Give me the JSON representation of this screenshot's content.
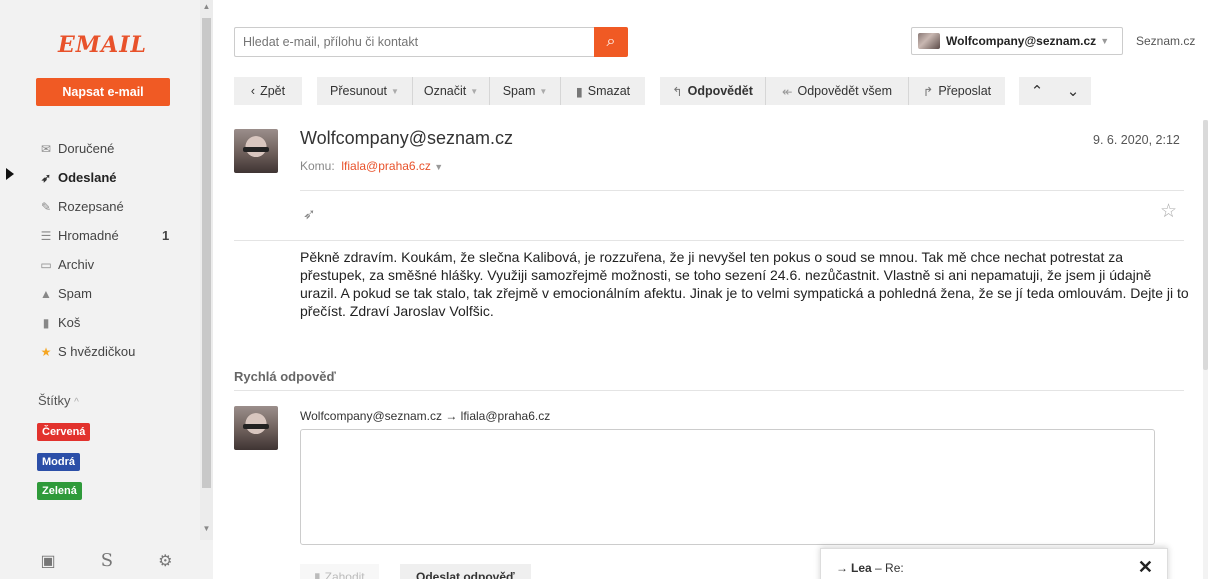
{
  "sidebar": {
    "logo": "EMAIL",
    "compose_label": "Napsat e-mail",
    "items": [
      {
        "icon": "envelope-icon",
        "glyph": "✉",
        "label": "Doručené",
        "count": ""
      },
      {
        "icon": "paper-plane-icon",
        "glyph": "➶",
        "label": "Odeslané",
        "count": ""
      },
      {
        "icon": "draft-icon",
        "glyph": "✎",
        "label": "Rozepsané",
        "count": ""
      },
      {
        "icon": "bulk-icon",
        "glyph": "☰",
        "label": "Hromadné",
        "count": "1"
      },
      {
        "icon": "archive-icon",
        "glyph": "▭",
        "label": "Archiv",
        "count": ""
      },
      {
        "icon": "spam-icon",
        "glyph": "▲",
        "label": "Spam",
        "count": ""
      },
      {
        "icon": "trash-icon",
        "glyph": "▮",
        "label": "Koš",
        "count": ""
      },
      {
        "icon": "star-icon",
        "glyph": "★",
        "label": "S hvězdičkou",
        "count": ""
      }
    ],
    "active_item": "Odeslané",
    "labels_heading": "Štítky",
    "labels_caret": "^",
    "tags": [
      {
        "label": "Červená",
        "color": "#e2322d"
      },
      {
        "label": "Modrá",
        "color": "#2c4fa8"
      },
      {
        "label": "Zelená",
        "color": "#2f9a3a"
      }
    ],
    "footer_icons": [
      "calendar-icon",
      "seznam-logo-icon",
      "settings-gear-icon"
    ]
  },
  "topbar": {
    "search_placeholder": "Hledat e-mail, přílohu či kontakt",
    "account": "Wolfcompany@seznam.cz",
    "seznam_link": "Seznam.cz"
  },
  "toolbar": {
    "back": "Zpět",
    "move": "Přesunout",
    "mark": "Označit",
    "spam": "Spam",
    "delete": "Smazat",
    "reply": "Odpovědět",
    "reply_all": "Odpovědět všem",
    "forward": "Přeposlat"
  },
  "message": {
    "sender": "Wolfcompany@seznam.cz",
    "to_label": "Komu:",
    "to": "lfiala@praha6.cz",
    "date": "9. 6. 2020, 2:12",
    "body": "Pěkně zdravím. Koukám, že slečna Kalibová, je rozzuřena, že ji nevyšel ten pokus o soud se mnou. Tak mě chce nechat potrestat za přestupek, za směšné hlášky. Využiji samozřejmě možnosti, se toho sezení 24.6. nezůčastnit. Vlastně si ani nepamatuji, že jsem ji údajně urazil. A pokud se tak stalo, tak zřejmě v emocionálním afektu. Jinak je to velmi sympatická a pohledná žena, že se jí teda omlouvám. Dejte ji to přečíst. Zdraví Jaroslav Volfšic."
  },
  "quick_reply": {
    "heading": "Rychlá odpověď",
    "route": "Wolfcompany@seznam.cz → lfiala@praha6.cz",
    "discard": "Zahodit",
    "send": "Odeslat odpověď"
  },
  "popup": {
    "arrow": "→",
    "name": "Lea",
    "subject": "– Re:",
    "close": "✕"
  }
}
